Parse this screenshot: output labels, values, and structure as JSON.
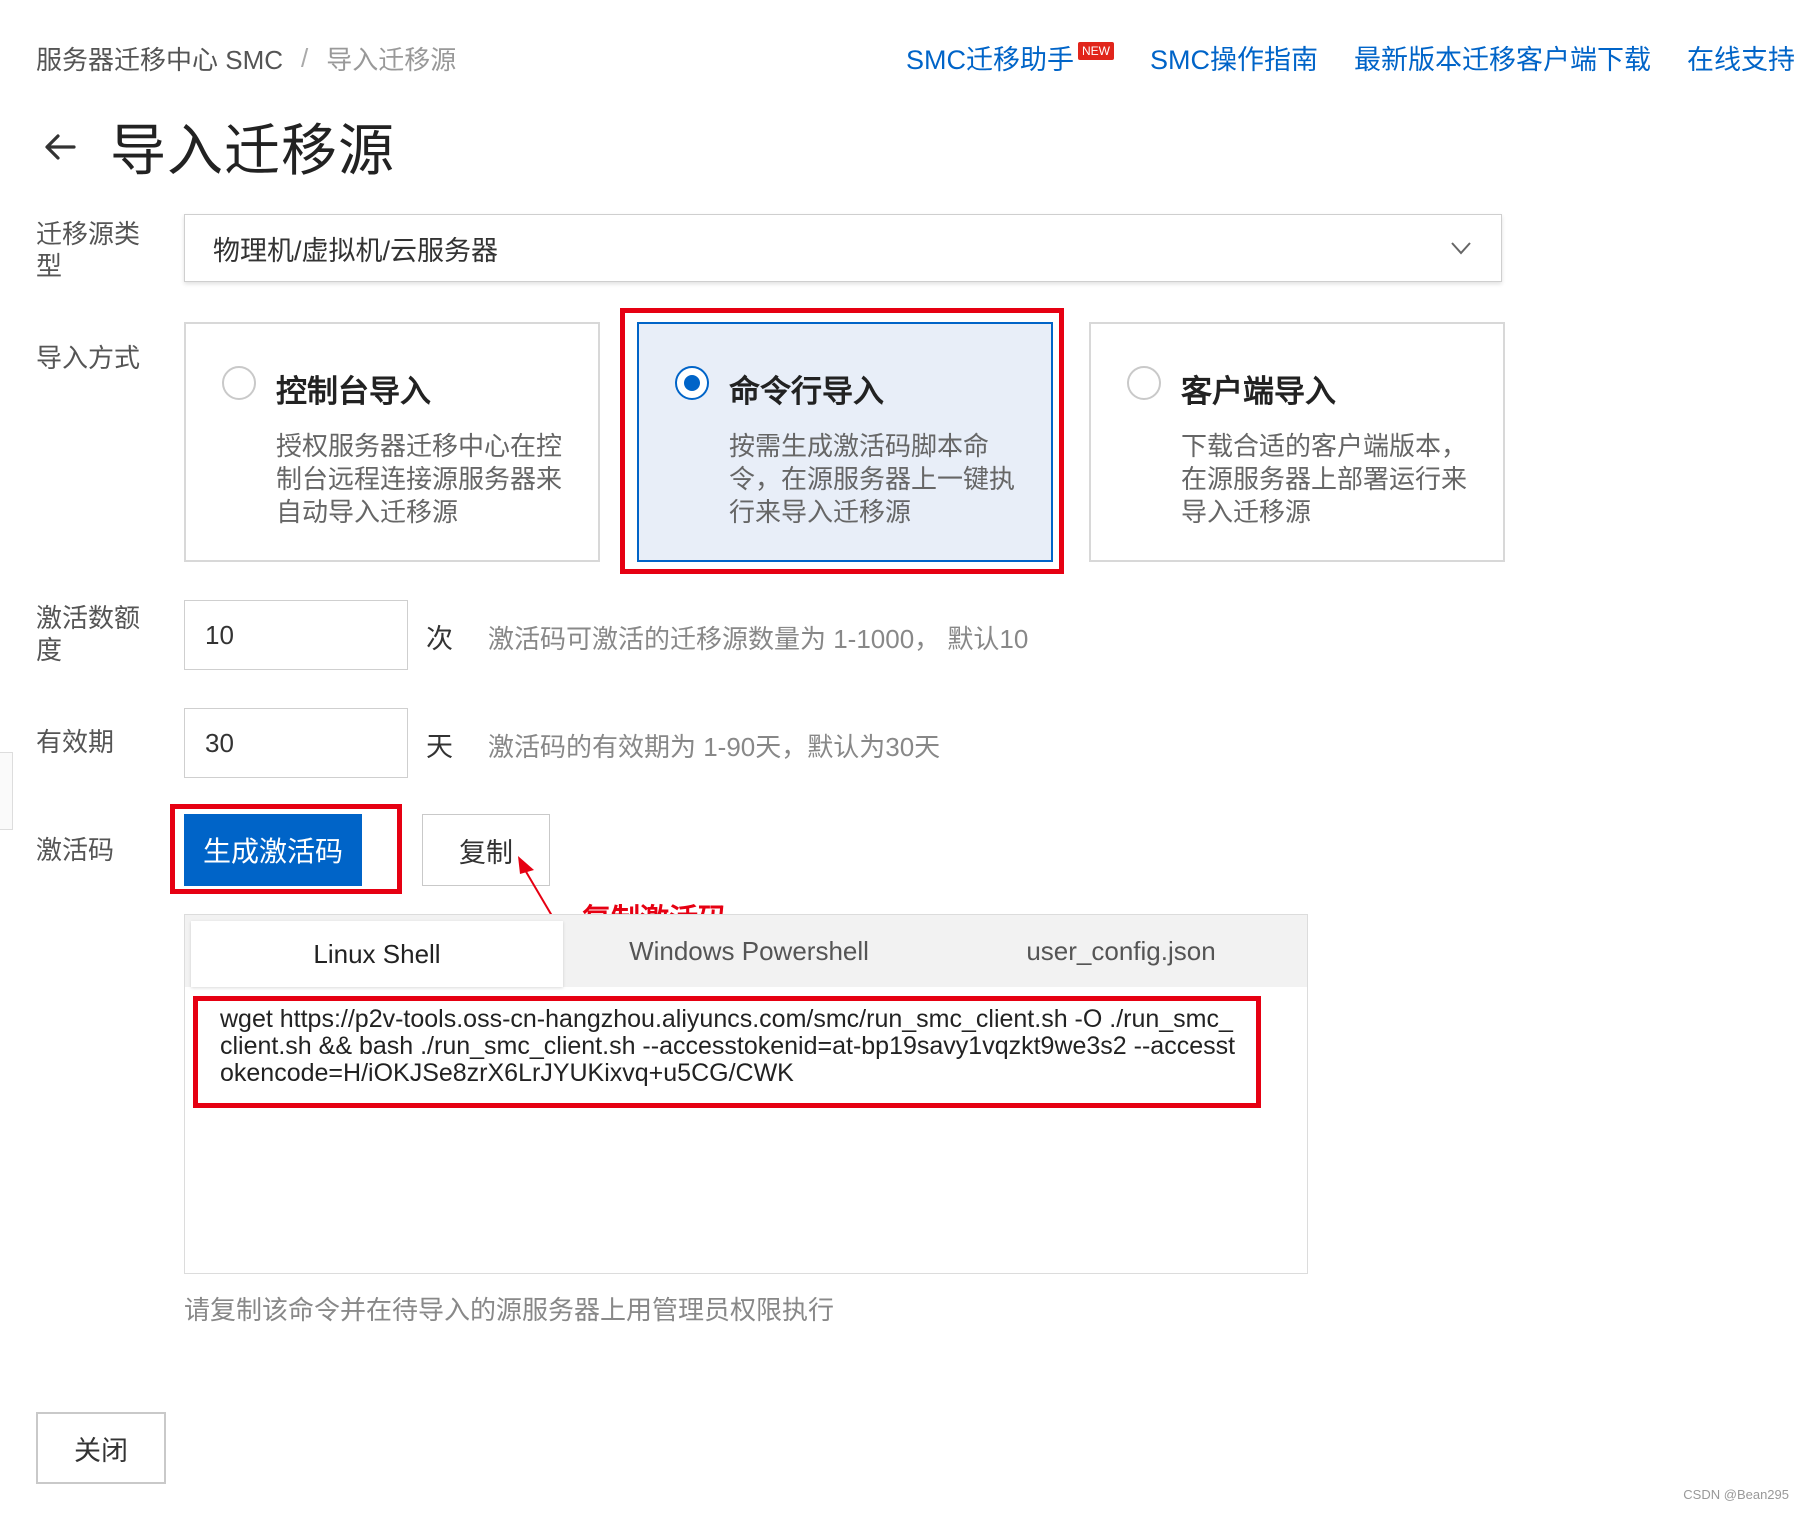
{
  "breadcrumb": {
    "root": "服务器迁移中心 SMC",
    "separator": "/",
    "current": "导入迁移源"
  },
  "top_links": {
    "assistant": "SMC迁移助手",
    "new_badge": "NEW",
    "guide": "SMC操作指南",
    "download": "最新版本迁移客户端下载",
    "support": "在线支持"
  },
  "page_title": "导入迁移源",
  "source_type": {
    "label": "迁移源类型",
    "value": "物理机/虚拟机/云服务器"
  },
  "import_method": {
    "label": "导入方式",
    "options": [
      {
        "title": "控制台导入",
        "desc": "授权服务器迁移中心在控制台远程连接源服务器来自动导入迁移源",
        "selected": false
      },
      {
        "title": "命令行导入",
        "desc": "按需生成激活码脚本命令，在源服务器上一键执行来导入迁移源",
        "selected": true
      },
      {
        "title": "客户端导入",
        "desc": "下载合适的客户端版本，在源服务器上部署运行来导入迁移源",
        "selected": false
      }
    ]
  },
  "quota": {
    "label": "激活数额度",
    "value": "10",
    "unit": "次",
    "hint": "激活码可激活的迁移源数量为 1-1000， 默认10"
  },
  "validity": {
    "label": "有效期",
    "value": "30",
    "unit": "天",
    "hint": "激活码的有效期为 1-90天，默认为30天"
  },
  "activation": {
    "label": "激活码",
    "generate_button": "生成激活码",
    "copy_button": "复制",
    "annotation": "复制激活码"
  },
  "code_tabs": [
    "Linux Shell",
    "Windows Powershell",
    "user_config.json"
  ],
  "active_tab": "Linux Shell",
  "command": "wget https://p2v-tools.oss-cn-hangzhou.aliyuncs.com/smc/run_smc_client.sh -O ./run_smc_client.sh && bash ./run_smc_client.sh --accesstokenid=at-bp19savy1vqzkt9we3s2 --accesstokencode=H/iOKJSe8zrX6LrJYUKixvq+u5CG/CWK",
  "command_note": "请复制该命令并在待导入的源服务器上用管理员权限执行",
  "close_button": "关闭",
  "watermark": "CSDN @Bean295",
  "colors": {
    "primary": "#0064c8",
    "highlight_red": "#e60012",
    "selected_card_bg": "#e8eef8"
  }
}
